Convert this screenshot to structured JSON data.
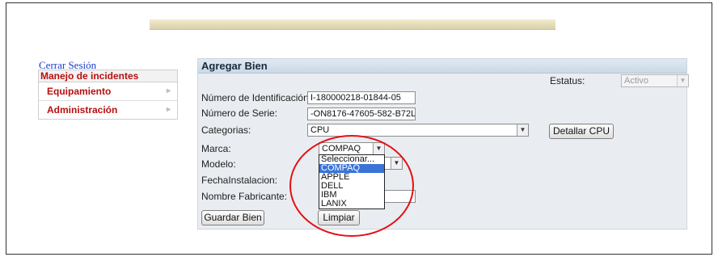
{
  "logout": "Cerrar Sesión",
  "sidebar": {
    "title": "Manejo de incidentes",
    "items": [
      {
        "label": "Equipamiento"
      },
      {
        "label": "Administración"
      }
    ]
  },
  "form": {
    "title": "Agregar Bien",
    "status_label": "Estatus:",
    "status_value": "Activo",
    "id_label": "Número de Identificación:",
    "id_value": "I-180000218-01844-05",
    "serial_label": "Número de Serie:",
    "serial_value": "-ON8176-47605-582-B72L",
    "category_label": "Categorias:",
    "category_value": "CPU",
    "detail_button": "Detallar CPU",
    "brand_label": "Marca:",
    "brand_value": "COMPAQ",
    "model_label": "Modelo:",
    "install_label": "FechaInstalacion:",
    "maker_label": "Nombre Fabricante:",
    "save_button": "Guardar Bien",
    "clear_button": "Limpiar",
    "brand_options": [
      "Seleccionar...",
      "COMPAQ",
      "APPLE",
      "DELL",
      "IBM",
      "LANIX"
    ],
    "brand_selected": "COMPAQ"
  },
  "colors": {
    "menu_text": "#b80f0f",
    "dropdown_highlight": "#3a74d6",
    "annotation_circle": "#e60f12"
  }
}
